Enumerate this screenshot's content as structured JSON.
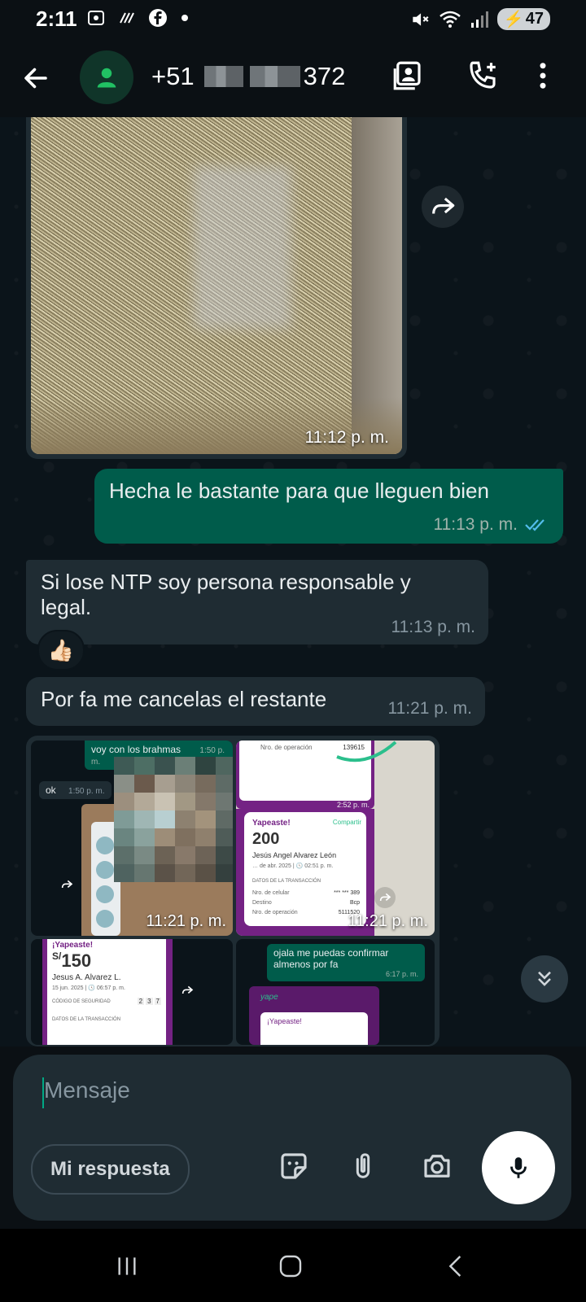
{
  "status_bar": {
    "time": "2:11",
    "battery": "47"
  },
  "header": {
    "phone_prefix": "+51",
    "phone_suffix": "372"
  },
  "messages": {
    "m1_time": "11:12 p. m.",
    "m2_text": "Hecha le bastante para que lleguen bien",
    "m2_time": "11:13 p. m.",
    "m3_text": "Si lose NTP soy persona responsable y legal.",
    "m3_time": "11:13 p. m.",
    "reaction": "👍🏻",
    "m4_text": "Por fa me cancelas el restante",
    "m4_time": "11:21 p. m."
  },
  "album": {
    "tile1": {
      "time": "11:21 p. m.",
      "mini_msg1": "voy con los brahmas",
      "mini_msg1_time": "1:50 p. m.",
      "mini_msg2": "ok",
      "mini_msg2_time": "1:50 p. m."
    },
    "tile2": {
      "time": "11:21 p. m.",
      "nro_label": "Nro. de operación",
      "nro_value": "139615",
      "top_time": "2:52 p. m.",
      "yapeaste": "Yapeaste!",
      "compartir": "Compartir",
      "amount": "200",
      "name": "Jesús Angel Alvarez León",
      "date": "… de abr. 2025 | 🕓 02:51 p. m.",
      "section": "DATOS DE LA TRANSACCIÓN",
      "celular_label": "Nro. de celular",
      "celular_value": "*** *** 389",
      "destino_label": "Destino",
      "destino_value": "Bcp",
      "op_label": "Nro. de operación",
      "op_value": "5111520"
    },
    "tile3": {
      "yapeaste": "¡Yapeaste!",
      "currency": "S/",
      "amount": "150",
      "name": "Jesus A. Alvarez L.",
      "date": "15 jun. 2025 | 🕓 06:57 p. m.",
      "codigo_label": "CÓDIGO DE SEGURIDAD",
      "codigo": [
        "2",
        "3",
        "7"
      ],
      "section": "DATOS DE LA TRANSACCIÓN"
    },
    "tile4": {
      "msg": "ojala me puedas confirmar almenos por fa",
      "msg_time": "6:17 p. m.",
      "yape_logo": "yape",
      "yapeaste": "¡Yapeaste!"
    }
  },
  "composer": {
    "placeholder": "Mensaje",
    "chip": "Mi respuesta"
  },
  "icons": [
    "back-arrow-icon",
    "person-icon",
    "contact-card-icon",
    "add-call-icon",
    "more-vert-icon",
    "forward-icon",
    "scroll-down-icon",
    "sticker-icon",
    "attach-icon",
    "camera-icon",
    "mic-icon"
  ]
}
